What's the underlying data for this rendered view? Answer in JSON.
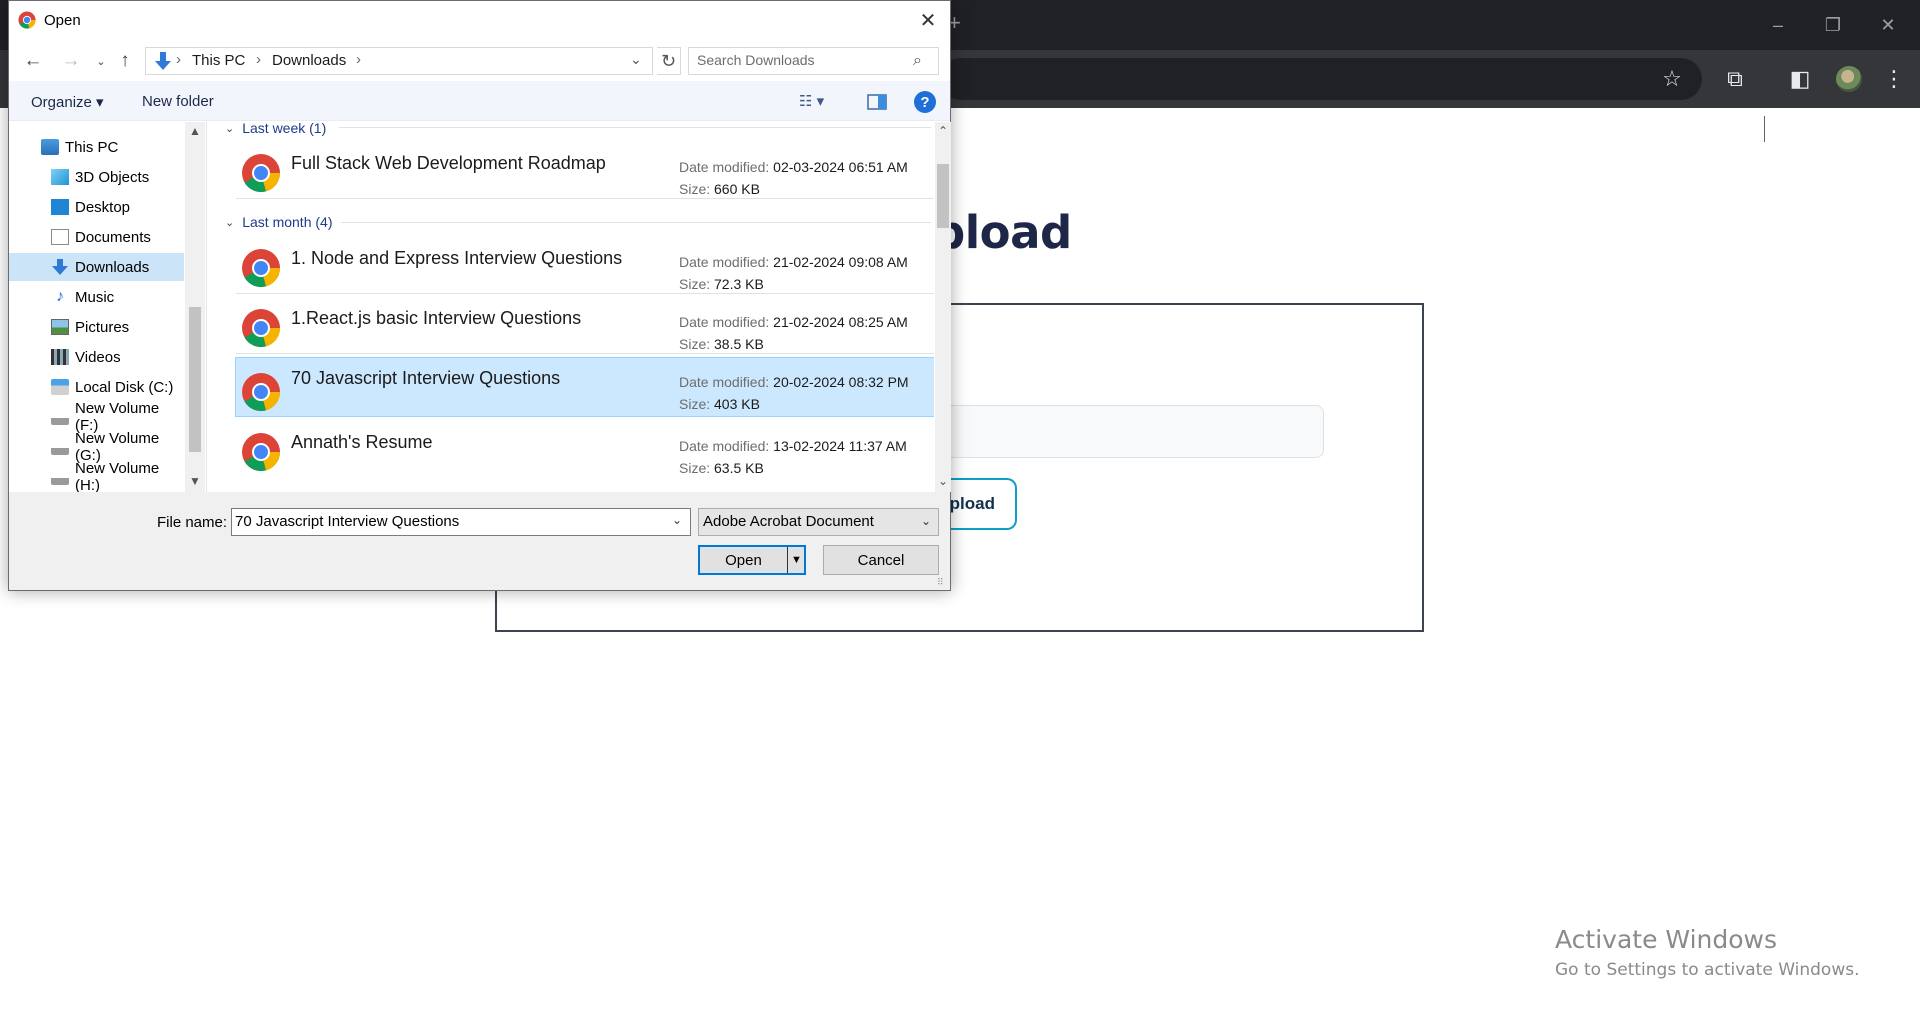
{
  "dialog": {
    "title": "Open",
    "close_icon": "close-icon"
  },
  "nav": {
    "breadcrumbs": [
      "This PC",
      "Downloads"
    ],
    "search_placeholder": "Search Downloads"
  },
  "commands": {
    "organize": "Organize ▾",
    "new_folder": "New folder",
    "help": "?"
  },
  "sidebar": {
    "items": [
      {
        "label": "This PC",
        "icon": "computer-icon"
      },
      {
        "label": "3D Objects",
        "icon": "cube-icon"
      },
      {
        "label": "Desktop",
        "icon": "desktop-icon"
      },
      {
        "label": "Documents",
        "icon": "document-icon"
      },
      {
        "label": "Downloads",
        "icon": "download-icon",
        "selected": true
      },
      {
        "label": "Music",
        "icon": "music-icon"
      },
      {
        "label": "Pictures",
        "icon": "picture-icon"
      },
      {
        "label": "Videos",
        "icon": "video-icon"
      },
      {
        "label": "Local Disk (C:)",
        "icon": "drive-icon"
      },
      {
        "label": "New Volume (F:)",
        "icon": "drive-icon"
      },
      {
        "label": "New Volume (G:)",
        "icon": "drive-icon"
      },
      {
        "label": "New Volume (H:)",
        "icon": "drive-icon"
      }
    ]
  },
  "files": {
    "groups": [
      {
        "label": "Last week (1)",
        "items": [
          {
            "name": "Full Stack Web Development Roadmap",
            "date_label": "Date modified:",
            "date": "02-03-2024 06:51 AM",
            "size_label": "Size:",
            "size": "660 KB"
          }
        ]
      },
      {
        "label": "Last month (4)",
        "items": [
          {
            "name": "1. Node and Express Interview Questions",
            "date_label": "Date modified:",
            "date": "21-02-2024 09:08 AM",
            "size_label": "Size:",
            "size": "72.3 KB"
          },
          {
            "name": "1.React.js basic Interview Questions",
            "date_label": "Date modified:",
            "date": "21-02-2024 08:25 AM",
            "size_label": "Size:",
            "size": "38.5 KB"
          },
          {
            "name": "70 Javascript Interview Questions",
            "date_label": "Date modified:",
            "date": "20-02-2024 08:32 PM",
            "size_label": "Size:",
            "size": "403 KB",
            "selected": true
          },
          {
            "name": "Annath's Resume",
            "date_label": "Date modified:",
            "date": "13-02-2024 11:37 AM",
            "size_label": "Size:",
            "size": "63.5 KB"
          }
        ]
      }
    ]
  },
  "footer": {
    "file_name_label": "File name:",
    "file_name_value": "70 Javascript Interview Questions",
    "file_type": "Adobe Acrobat Document",
    "open_label": "Open",
    "cancel_label": "Cancel"
  },
  "page": {
    "heading": "Upload",
    "upload_button": "Upload"
  },
  "watermark": {
    "title": "Activate Windows",
    "subtitle": "Go to Settings to activate Windows."
  },
  "colors": {
    "selection": "#cce8ff",
    "accent": "#0078d7",
    "browser_dark": "#202124",
    "heading": "#1e2747"
  }
}
